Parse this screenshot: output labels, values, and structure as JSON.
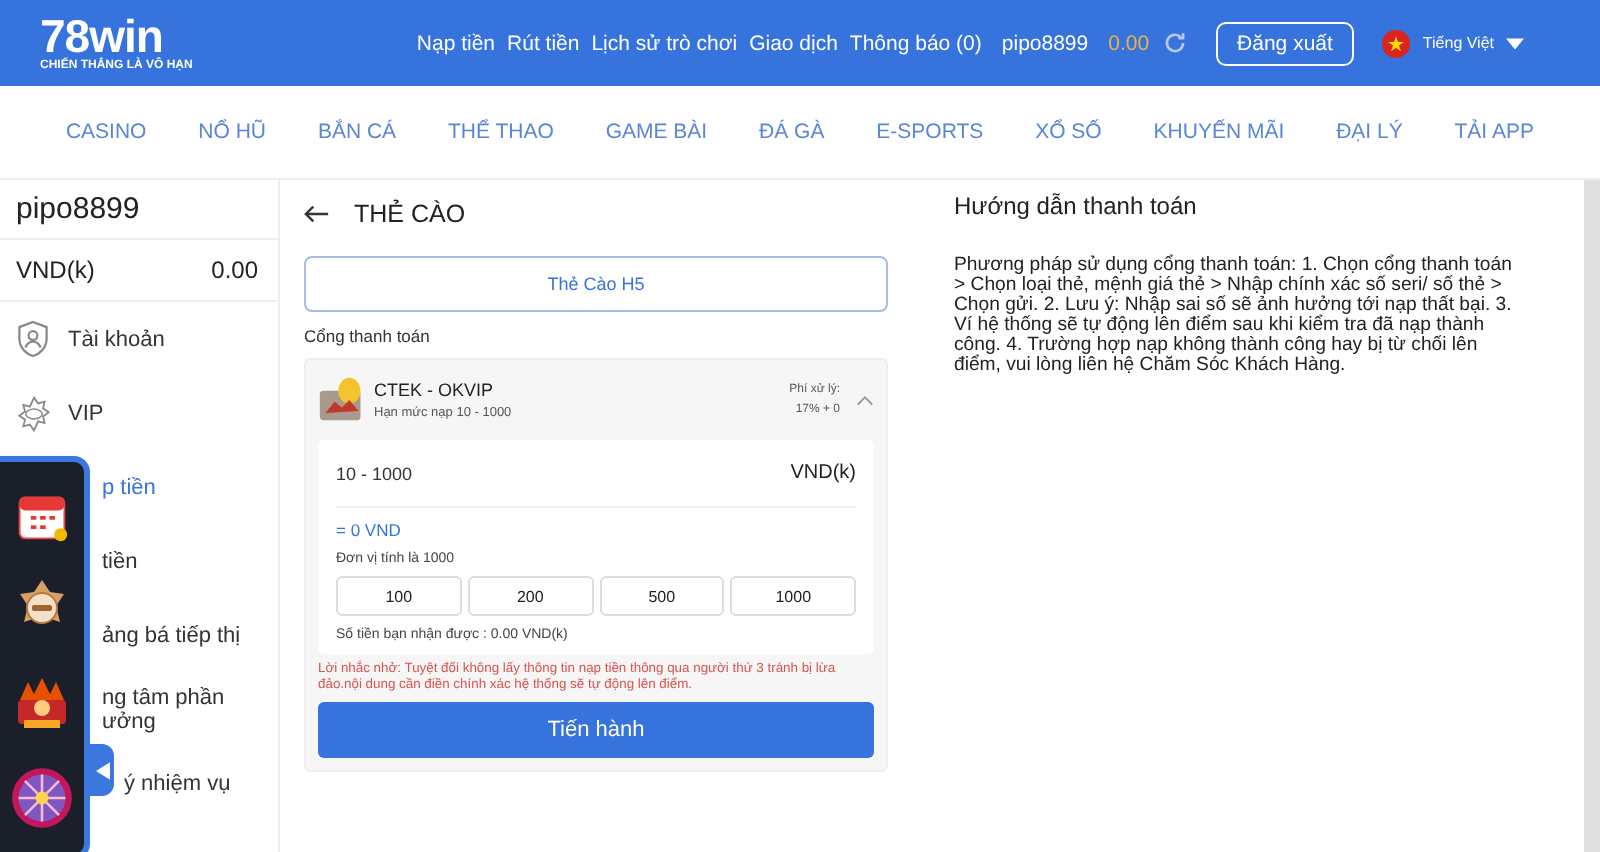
{
  "header": {
    "logo": {
      "name": "78win",
      "tagline": "CHIẾN THẮNG LÀ VÔ HẠN"
    },
    "links": [
      "Nạp tiền",
      "Rút tiền",
      "Lịch sử trò chơi",
      "Giao dịch",
      "Thông báo (0)"
    ],
    "username": "pipo8899",
    "balance": "0.00",
    "logout": "Đăng xuất",
    "language": "Tiếng Việt"
  },
  "nav": [
    "CASINO",
    "NỔ HŨ",
    "BẮN CÁ",
    "THỂ THAO",
    "GAME BÀI",
    "ĐÁ GÀ",
    "E-SPORTS",
    "XỔ SỐ",
    "KHUYẾN MÃI",
    "ĐẠI LÝ",
    "TẢI APP"
  ],
  "sidebar": {
    "username": "pipo8899",
    "currency": "VND(k)",
    "balance": "0.00",
    "items": [
      {
        "label": "Tài khoản",
        "selected": false
      },
      {
        "label": "VIP",
        "selected": false
      },
      {
        "label": "p tiền",
        "selected": true
      },
      {
        "label": "tiền",
        "selected": false
      },
      {
        "label": "ảng bá tiếp thị",
        "selected": false
      },
      {
        "label": "ng tâm phần\nưởng",
        "selected": false
      },
      {
        "label": "ý nhiệm vụ",
        "selected": false
      }
    ]
  },
  "floating_menu": {
    "items": [
      {
        "kind": "calendar"
      },
      {
        "kind": "medal"
      },
      {
        "kind": "festive"
      },
      {
        "kind": "wheel"
      }
    ],
    "expanded": true
  },
  "deposit": {
    "title": "THẺ CÀO",
    "card_type": "Thẻ Cào H5",
    "section_label": "Cổng thanh toán",
    "gateway": {
      "name": "CTEK - OKVIP",
      "limit": "Hạn mức nạp 10 - 1000",
      "fee_label": "Phí xử lý:",
      "fee": "17% + 0",
      "expanded": true
    },
    "amount": {
      "placeholder": "10 - 1000",
      "unit": "VND(k)"
    },
    "converted": "= 0 VND",
    "unit_note": "Đơn vị tính là 1000",
    "presets": [
      "100",
      "200",
      "500",
      "1000"
    ],
    "receive": "Số tiền bạn nhận được : 0.00 VND(k)",
    "warning": "Lời nhắc nhở: Tuyệt đối không lấy thông tin nạp tiền thông qua người thứ 3 tránh bị lừa đảo.nội dung cần điền chính xác hệ thống sẽ tự động lên điểm.",
    "submit": "Tiến hành"
  },
  "guide": {
    "title": "Hướng dẫn thanh toán",
    "text": "Phương pháp sử dụng cổng thanh toán: 1. Chọn cổng thanh toán > Chọn loại thẻ, mệnh giá thẻ > Nhập chính xác số seri/ số thẻ > Chọn gửi. 2. Lưu ý: Nhập sai số sẽ ảnh hưởng tới nạp thất bại. 3. Ví hệ thống sẽ tự động lên điểm sau khi kiểm tra đã nạp thành công. 4. Trường hợp nạp không thành công hay bị từ chối lên điểm, vui lòng liên hệ Chăm Sóc Khách Hàng."
  }
}
